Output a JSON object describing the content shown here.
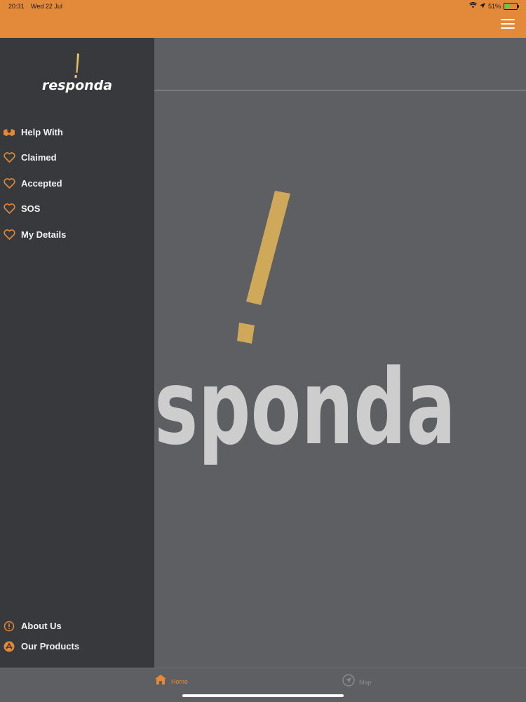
{
  "status": {
    "time": "20:31",
    "date": "Wed 22 Jul",
    "battery": "51%",
    "battery_level": 0.51
  },
  "colors": {
    "accent": "#e3893a",
    "sidebar_bg": "#37393c",
    "main_bg": "#5e5f62",
    "logo_yellow": "#cfa85a"
  },
  "header": {
    "menu_icon": "hamburger-menu-icon"
  },
  "sidebar": {
    "logo_text": "responda",
    "items": [
      {
        "label": "Help With",
        "icon": "helping-hands-icon"
      },
      {
        "label": "Claimed",
        "icon": "heart-outline-icon"
      },
      {
        "label": "Accepted",
        "icon": "heart-outline-icon"
      },
      {
        "label": "SOS",
        "icon": "heart-outline-icon"
      },
      {
        "label": "My Details",
        "icon": "heart-outline-icon"
      }
    ],
    "bottom_items": [
      {
        "label": "About Us",
        "icon": "info-circle-icon"
      },
      {
        "label": "Our Products",
        "icon": "app-store-icon"
      }
    ]
  },
  "main": {
    "logo_text": "sponda"
  },
  "tabbar": {
    "tabs": [
      {
        "label": "Home",
        "icon": "home-icon",
        "active": true
      },
      {
        "label": "Map",
        "icon": "navigation-arrow-icon",
        "active": false
      }
    ]
  }
}
